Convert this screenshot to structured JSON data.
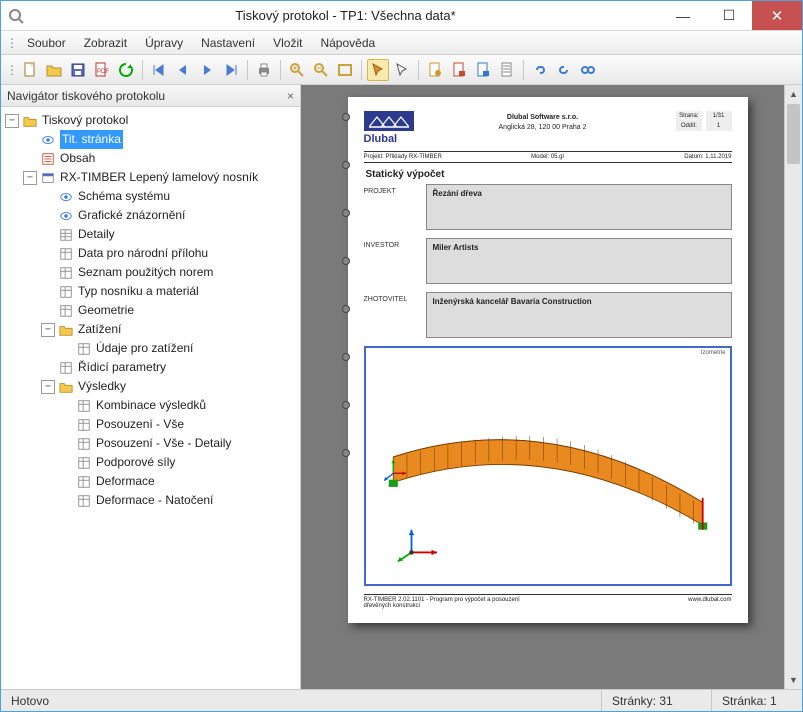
{
  "window": {
    "title": "Tiskový protokol - TP1: Všechna data*"
  },
  "menu": {
    "items": [
      "Soubor",
      "Zobrazit",
      "Úpravy",
      "Nastavení",
      "Vložit",
      "Nápověda"
    ]
  },
  "navigator": {
    "title": "Navigátor tiskového protokolu"
  },
  "tree": {
    "root": "Tiskový protokol",
    "n1": "Tit. stránka",
    "n2": "Obsah",
    "n3": "RX-TIMBER Lepený lamelový nosník",
    "n3_1": "Schéma systému",
    "n3_2": "Grafické znázornění",
    "n3_3": "Detaily",
    "n3_4": "Data pro národní přílohu",
    "n3_5": "Seznam použitých norem",
    "n3_6": "Typ nosníku a materiál",
    "n3_7": "Geometrie",
    "n3_8": "Zatížení",
    "n3_8_1": "Údaje pro zatížení",
    "n3_9": "Řídicí parametry",
    "n3_10": "Výsledky",
    "n3_10_1": "Kombinace výsledků",
    "n3_10_2": "Posouzení - Vše",
    "n3_10_3": "Posouzení - Vše - Detaily",
    "n3_10_4": "Podporové síly",
    "n3_10_5": "Deformace",
    "n3_10_6": "Deformace - Natočení"
  },
  "page": {
    "company": "Dlubal Software s.r.o.",
    "address": "Anglická 28, 120 00 Praha 2",
    "logo_text": "Dlubal",
    "meta_page_lbl": "Strana:",
    "meta_page_val": "1/31",
    "meta_list_lbl": "Oddíl:",
    "meta_list_val": "1",
    "row2_a_lbl": "Projekt:",
    "row2_a_val": "Příklady RX-TIMBER",
    "row2_b_lbl": "Model:",
    "row2_b_val": "05.gl",
    "row2_c_lbl": "Datum:",
    "row2_c_val": "1.11.2019",
    "section_title": "Statický výpočet",
    "b1_lbl": "PROJEKT",
    "b1_val": "Řezání dřeva",
    "b2_lbl": "INVESTOR",
    "b2_val": "Miler Artists",
    "b3_lbl": "ZHOTOVITEL",
    "b3_val": "Inženýrská kancelář Bavaria Construction",
    "diag_tag": "Izometrie",
    "foot_left": "RX-TIMBER 2.02.1101 - Program pro výpočet a posouzení dřevěných konstrukcí",
    "foot_right": "www.dlubal.com"
  },
  "status": {
    "left": "Hotovo",
    "pages": "Stránky: 31",
    "page": "Stránka: 1"
  }
}
